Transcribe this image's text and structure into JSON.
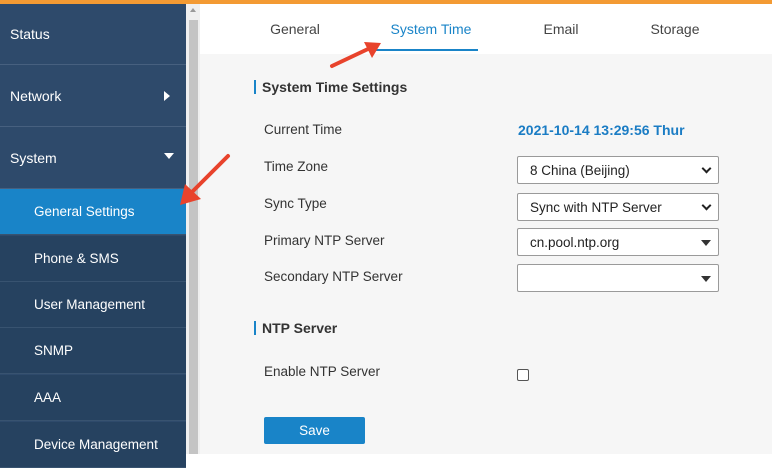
{
  "sidebar": {
    "items": [
      {
        "label": "Status"
      },
      {
        "label": "Network"
      },
      {
        "label": "System"
      }
    ],
    "sub_items": [
      {
        "label": "General Settings"
      },
      {
        "label": "Phone & SMS"
      },
      {
        "label": "User Management"
      },
      {
        "label": "SNMP"
      },
      {
        "label": "AAA"
      },
      {
        "label": "Device Management"
      }
    ]
  },
  "tabs": [
    "General",
    "System Time",
    "Email",
    "Storage"
  ],
  "active_tab": "System Time",
  "system_time": {
    "section_title": "System Time Settings",
    "current_time_label": "Current Time",
    "current_time_value": "2021-10-14 13:29:56 Thur",
    "time_zone_label": "Time Zone",
    "time_zone_value": "8 China (Beijing)",
    "sync_type_label": "Sync Type",
    "sync_type_value": "Sync with NTP Server",
    "primary_ntp_label": "Primary NTP Server",
    "primary_ntp_value": "cn.pool.ntp.org",
    "secondary_ntp_label": "Secondary NTP Server",
    "secondary_ntp_value": ""
  },
  "ntp_server": {
    "section_title": "NTP Server",
    "enable_label": "Enable NTP Server",
    "enabled": false
  },
  "save_label": "Save",
  "colors": {
    "accent": "#1984c8",
    "sidebar": "#2e4a6b",
    "top_bar": "#f39a33",
    "annotation_arrow": "#e8432c"
  },
  "icons": [
    "chevron-right-icon",
    "chevron-down-icon",
    "dropdown-icon",
    "annotation-arrow-icon"
  ]
}
